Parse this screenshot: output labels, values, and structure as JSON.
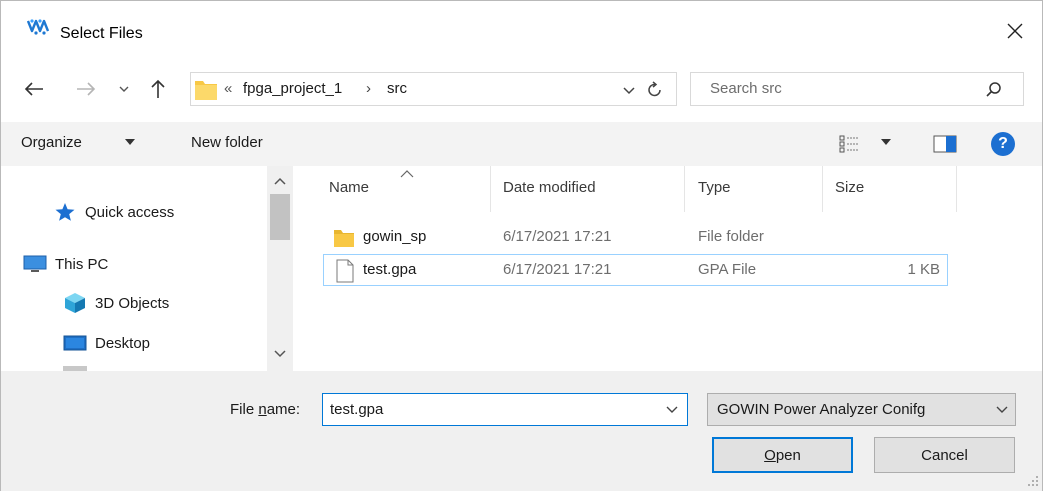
{
  "window": {
    "title": "Select Files",
    "close_glyph": "✕"
  },
  "address_bar": {
    "overflow_glyph": "«",
    "crumbs": [
      "fpga_project_1",
      "src"
    ],
    "separator": "›"
  },
  "search": {
    "placeholder": "Search src"
  },
  "toolbar": {
    "organize_label": "Organize",
    "new_folder_label": "New folder",
    "help_label": "?"
  },
  "nav_pane": {
    "items": [
      {
        "label": "Quick access",
        "icon": "star-icon"
      },
      {
        "label": "This PC",
        "icon": "computer-icon"
      },
      {
        "label": "3D Objects",
        "icon": "cube-icon"
      },
      {
        "label": "Desktop",
        "icon": "desktop-icon"
      }
    ]
  },
  "file_list": {
    "columns": [
      "Name",
      "Date modified",
      "Type",
      "Size"
    ],
    "rows": [
      {
        "name": "gowin_sp",
        "date": "6/17/2021 17:21",
        "type": "File folder",
        "size": "",
        "icon": "folder-icon"
      },
      {
        "name": "test.gpa",
        "date": "6/17/2021 17:21",
        "type": "GPA File",
        "size": "1 KB",
        "icon": "file-icon",
        "selected": true
      }
    ]
  },
  "bottom": {
    "file_name_label_pre": "File ",
    "file_name_label_underlined": "n",
    "file_name_label_post": "ame:",
    "file_name_value": "test.gpa",
    "filter_value": "GOWIN Power Analyzer Conifg",
    "open_label_underlined": "O",
    "open_label_rest": "pen",
    "cancel_label": "Cancel"
  },
  "colors": {
    "accent": "#0078d7",
    "selection_border": "#99d1ff",
    "folder": "#f8c845",
    "help": "#1c6fd1"
  }
}
